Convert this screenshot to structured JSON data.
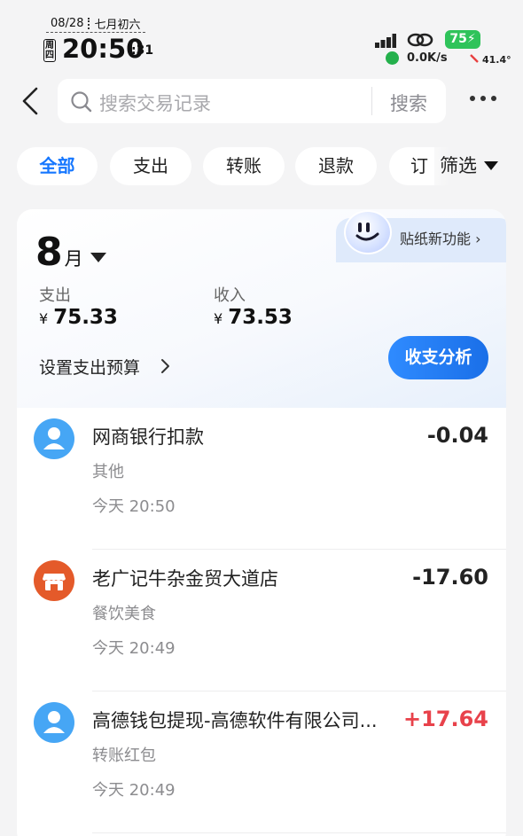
{
  "status_bar": {
    "date": "08/28",
    "lunar": "七月初六",
    "weekday": "周四",
    "time": "20:50",
    "seconds": ":31",
    "battery": "75",
    "net_speed": "0.0K/s",
    "temperature": "41.4°"
  },
  "header": {
    "search_placeholder": "搜索交易记录",
    "search_button": "搜索"
  },
  "chips": [
    {
      "label": "全部",
      "active": true
    },
    {
      "label": "支出",
      "active": false
    },
    {
      "label": "转账",
      "active": false
    },
    {
      "label": "退款",
      "active": false
    },
    {
      "label": "订",
      "active": false
    }
  ],
  "filter_label": "筛选",
  "summary": {
    "sticker_label": "贴纸新功能 ›",
    "month_number": "8",
    "month_unit": "月",
    "expense_label": "支出",
    "expense_currency": "¥",
    "expense_value": "75.33",
    "income_label": "收入",
    "income_currency": "¥",
    "income_value": "73.53",
    "budget_label": "设置支出预算",
    "analysis_button": "收支分析"
  },
  "transactions": [
    {
      "title": "网商银行扣款",
      "category": "其他",
      "time": "今天 20:50",
      "amount": "-0.04",
      "type": "expense",
      "icon": "person-icon",
      "icon_color": "#46a6f5"
    },
    {
      "title": "老广记牛杂金贸大道店",
      "category": "餐饮美食",
      "time": "今天 20:49",
      "amount": "-17.60",
      "type": "expense",
      "icon": "store-icon",
      "icon_color": "#e45a2a"
    },
    {
      "title": "高德钱包提现-高德软件有限公司...",
      "category": "转账红包",
      "time": "今天 20:49",
      "amount": "+17.64",
      "type": "income",
      "icon": "person-icon",
      "icon_color": "#46a6f5"
    }
  ],
  "colors": {
    "accent": "#1677ff",
    "income": "#e8424b",
    "battery": "#2fc35a"
  }
}
